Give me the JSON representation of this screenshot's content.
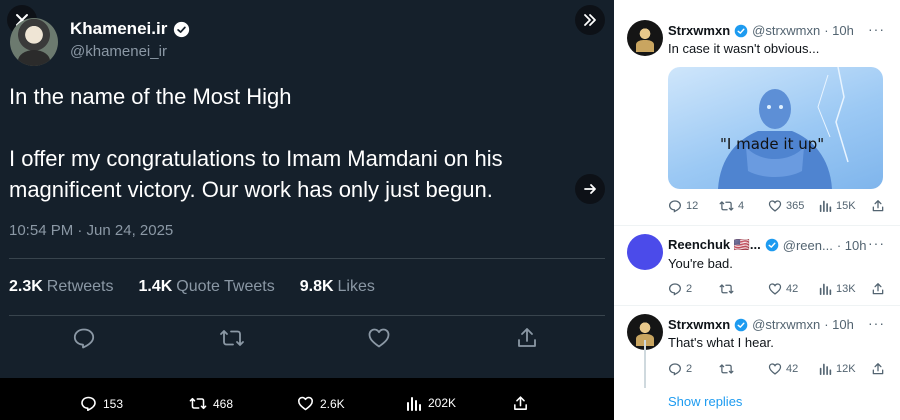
{
  "tweet": {
    "author_name": "Khamenei.ir",
    "author_handle": "@khamenei_ir",
    "text_line1": "In the name of the Most High",
    "text_line2": "I offer my congratulations to Imam Mamdani on his magnificent victory. Our work has only just begun.",
    "timestamp": "10:54 PM · Jun 24, 2025",
    "retweets_count": "2.3K",
    "retweets_label": "Retweets",
    "quotes_count": "1.4K",
    "quotes_label": "Quote Tweets",
    "likes_count": "9.8K",
    "likes_label": "Likes"
  },
  "bottom_bar": {
    "replies": "153",
    "retweets": "468",
    "likes": "2.6K",
    "views": "202K"
  },
  "replies": [
    {
      "name": "Strxwmxn",
      "handle": "@strxwmxn",
      "time": "· 10h",
      "text": "In case it wasn't obvious...",
      "image_caption": "\"I made it up\"",
      "reply_count": "12",
      "retweet_count": "4",
      "like_count": "365",
      "view_count": "15K"
    },
    {
      "name": "Reenchuk 🇺🇸...",
      "handle": "@reen...",
      "time": "· 10h",
      "text": "You're bad.",
      "reply_count": "2",
      "retweet_count": "",
      "like_count": "42",
      "view_count": "13K"
    },
    {
      "name": "Strxwmxn",
      "handle": "@strxwmxn",
      "time": "· 10h",
      "text": "That's what I hear.",
      "reply_count": "2",
      "retweet_count": "",
      "like_count": "42",
      "view_count": "12K"
    }
  ],
  "show_replies_label": "Show replies",
  "colors": {
    "panel_dark": "#15202b",
    "verified": "#1d9bf0",
    "link": "#1d9bf0",
    "muted": "#536471"
  }
}
